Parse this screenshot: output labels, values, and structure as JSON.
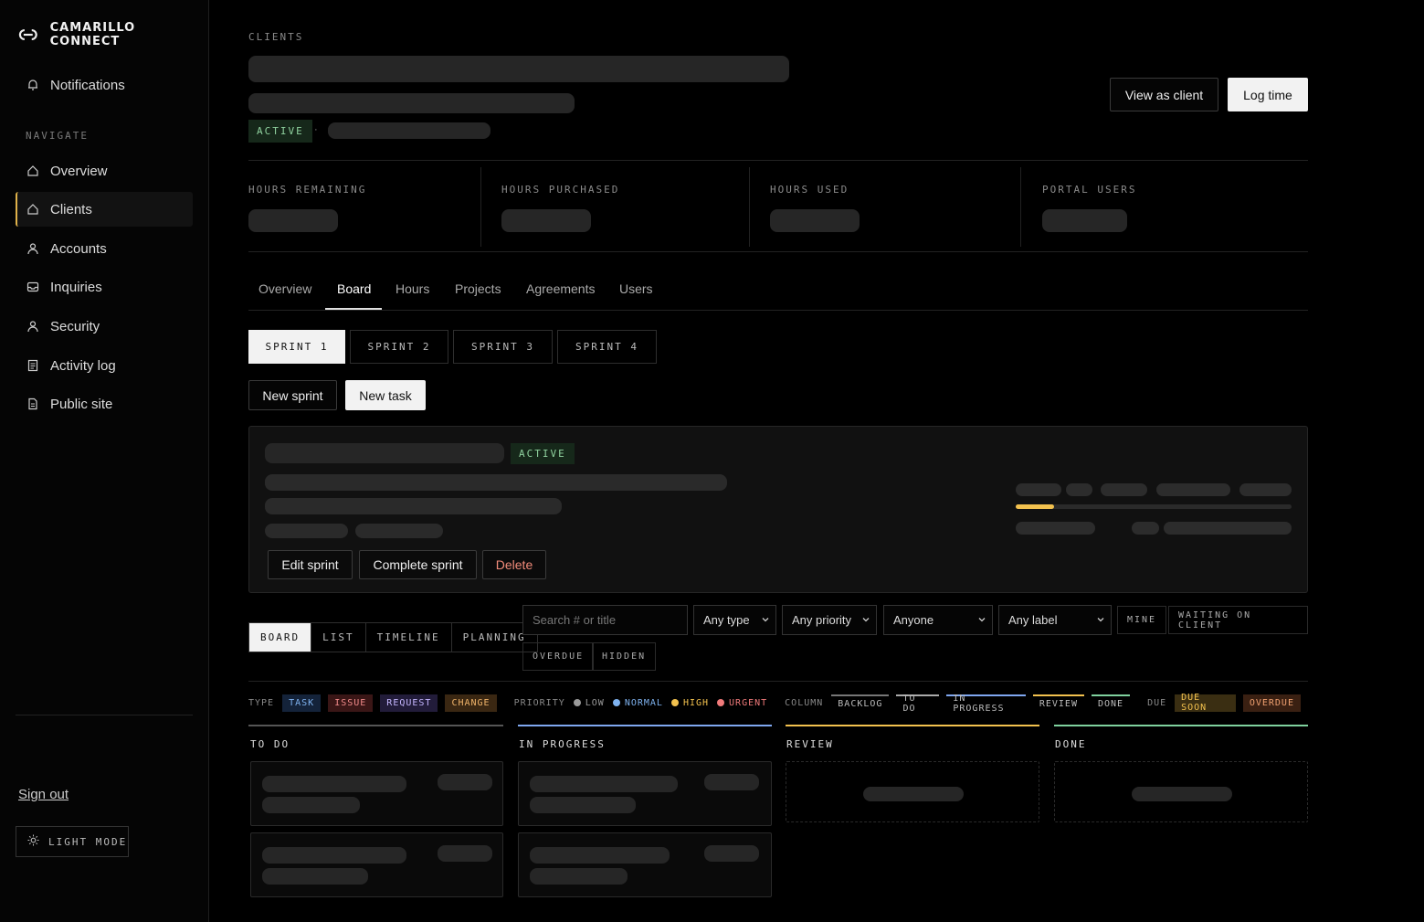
{
  "brand": {
    "name": "CAMARILLO CONNECT"
  },
  "sidebar": {
    "notifications": "Notifications",
    "nav_label": "NAVIGATE",
    "items": [
      {
        "label": "Overview",
        "icon": "home-icon"
      },
      {
        "label": "Clients",
        "icon": "home-icon",
        "active": true
      },
      {
        "label": "Accounts",
        "icon": "user-icon"
      },
      {
        "label": "Inquiries",
        "icon": "inbox-icon"
      },
      {
        "label": "Security",
        "icon": "user-icon"
      },
      {
        "label": "Activity log",
        "icon": "log-icon"
      },
      {
        "label": "Public site",
        "icon": "document-icon"
      }
    ],
    "sign_out": "Sign out",
    "light_mode": "LIGHT MODE"
  },
  "header": {
    "section": "CLIENTS",
    "status": "ACTIVE",
    "separator": "·",
    "view_as_client": "View as client",
    "log_time": "Log time"
  },
  "stats": [
    {
      "label": "HOURS REMAINING"
    },
    {
      "label": "HOURS PURCHASED"
    },
    {
      "label": "HOURS USED"
    },
    {
      "label": "PORTAL USERS"
    }
  ],
  "tabs": [
    "Overview",
    "Board",
    "Hours",
    "Projects",
    "Agreements",
    "Users"
  ],
  "active_tab": "Board",
  "sprints": [
    "SPRINT 1",
    "SPRINT 2",
    "SPRINT 3",
    "SPRINT 4"
  ],
  "actions": {
    "new_sprint": "New sprint",
    "new_task": "New task"
  },
  "sprint_card": {
    "status": "ACTIVE",
    "progress": 0.14,
    "edit": "Edit sprint",
    "complete": "Complete sprint",
    "delete": "Delete"
  },
  "views": [
    "BOARD",
    "LIST",
    "TIMELINE",
    "PLANNING"
  ],
  "filters": {
    "search_placeholder": "Search # or title",
    "type": "Any type",
    "priority": "Any priority",
    "assignee": "Anyone",
    "label": "Any label",
    "mine": "MINE",
    "waiting": "WAITING ON CLIENT",
    "overdue": "OVERDUE",
    "hidden": "HIDDEN"
  },
  "legend": {
    "type_label": "TYPE",
    "types": [
      {
        "label": "TASK",
        "color": "#7fb3f0",
        "bg": "#14233a"
      },
      {
        "label": "ISSUE",
        "color": "#f08a8a",
        "bg": "#3a1616"
      },
      {
        "label": "REQUEST",
        "color": "#c4b5fd",
        "bg": "#221c3a"
      },
      {
        "label": "CHANGE",
        "color": "#f0b46a",
        "bg": "#3a2712"
      }
    ],
    "priority_label": "PRIORITY",
    "priorities": [
      {
        "label": "LOW",
        "color": "#9a9a9a"
      },
      {
        "label": "NORMAL",
        "color": "#7fb3f0"
      },
      {
        "label": "HIGH",
        "color": "#f2c14e"
      },
      {
        "label": "URGENT",
        "color": "#f07a7a"
      }
    ],
    "column_label": "COLUMN",
    "columns": [
      {
        "label": "BACKLOG",
        "color": "#777777"
      },
      {
        "label": "TO DO",
        "color": "#aaaaaa"
      },
      {
        "label": "IN PROGRESS",
        "color": "#7fa7f0"
      },
      {
        "label": "REVIEW",
        "color": "#f2c14e"
      },
      {
        "label": "DONE",
        "color": "#7fd19e"
      }
    ],
    "due_label": "DUE",
    "due": [
      {
        "label": "DUE SOON",
        "color": "#f2c14e",
        "bg": "#3a2e12"
      },
      {
        "label": "OVERDUE",
        "color": "#f0a070",
        "bg": "#3a2012"
      }
    ]
  },
  "board": [
    {
      "title": "TO DO",
      "color": "#555555"
    },
    {
      "title": "IN PROGRESS",
      "color": "#7fa7f0"
    },
    {
      "title": "REVIEW",
      "color": "#f2c14e"
    },
    {
      "title": "DONE",
      "color": "#7fd19e"
    }
  ]
}
